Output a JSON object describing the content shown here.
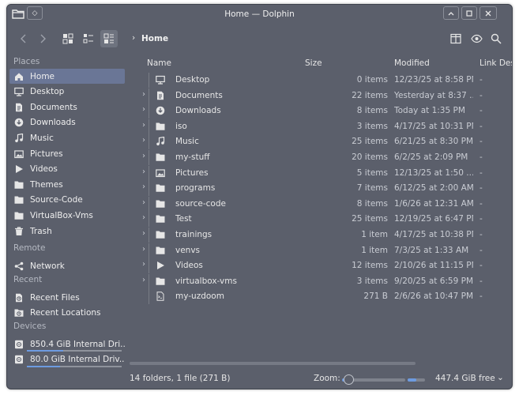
{
  "window": {
    "title": "Home — Dolphin"
  },
  "sidebar": {
    "sections": {
      "places": "Places",
      "remote": "Remote",
      "recent": "Recent",
      "devices": "Devices"
    },
    "places": [
      {
        "label": "Home",
        "icon": "home-icon",
        "selected": true
      },
      {
        "label": "Desktop",
        "icon": "desktop-icon"
      },
      {
        "label": "Documents",
        "icon": "document-icon"
      },
      {
        "label": "Downloads",
        "icon": "download-icon"
      },
      {
        "label": "Music",
        "icon": "music-icon"
      },
      {
        "label": "Pictures",
        "icon": "picture-icon"
      },
      {
        "label": "Videos",
        "icon": "video-icon"
      },
      {
        "label": "Themes",
        "icon": "folder-icon"
      },
      {
        "label": "Source-Code",
        "icon": "folder-icon"
      },
      {
        "label": "VirtualBox-Vms",
        "icon": "folder-icon"
      },
      {
        "label": "Trash",
        "icon": "trash-icon"
      }
    ],
    "remote": [
      {
        "label": "Network",
        "icon": "network-icon"
      }
    ],
    "recent": [
      {
        "label": "Recent Files",
        "icon": "recent-files-icon"
      },
      {
        "label": "Recent Locations",
        "icon": "recent-locations-icon"
      }
    ],
    "devices": [
      {
        "label": "850.4 GiB Internal Dri...",
        "icon": "drive-icon",
        "used_fraction": 0.38
      },
      {
        "label": "80.0 GiB Internal Driv...",
        "icon": "drive-icon",
        "used_fraction": 0.35
      }
    ]
  },
  "breadcrumb": {
    "location": "Home"
  },
  "columns": {
    "name": "Name",
    "size": "Size",
    "modified": "Modified",
    "link": "Link Desti"
  },
  "files": [
    {
      "name": "Desktop",
      "size": "0 items",
      "modified": "12/23/25 at 8:58 PM",
      "link": "-",
      "icon": "desktop-icon",
      "expandable": false
    },
    {
      "name": "Documents",
      "size": "22 items",
      "modified": "Yesterday at 8:37 ...",
      "link": "-",
      "icon": "document-icon",
      "expandable": true
    },
    {
      "name": "Downloads",
      "size": "8 items",
      "modified": "Today at 1:35 PM",
      "link": "-",
      "icon": "download-icon",
      "expandable": true
    },
    {
      "name": "iso",
      "size": "3 items",
      "modified": "4/17/25 at 10:31 PM",
      "link": "-",
      "icon": "folder-icon",
      "expandable": true
    },
    {
      "name": "Music",
      "size": "25 items",
      "modified": "6/21/25 at 8:30 PM",
      "link": "-",
      "icon": "music-icon",
      "expandable": true
    },
    {
      "name": "my-stuff",
      "size": "20 items",
      "modified": "6/2/25 at 2:09 PM",
      "link": "-",
      "icon": "folder-icon",
      "expandable": true
    },
    {
      "name": "Pictures",
      "size": "5 items",
      "modified": "12/13/25 at 1:50 ...",
      "link": "-",
      "icon": "picture-icon",
      "expandable": true
    },
    {
      "name": "programs",
      "size": "7 items",
      "modified": "6/12/25 at 2:00 AM",
      "link": "-",
      "icon": "folder-icon",
      "expandable": true
    },
    {
      "name": "source-code",
      "size": "8 items",
      "modified": "1/6/26 at 12:31 AM",
      "link": "-",
      "icon": "folder-icon",
      "expandable": true
    },
    {
      "name": "Test",
      "size": "25 items",
      "modified": "12/19/25 at 6:47 PM",
      "link": "-",
      "icon": "folder-icon",
      "expandable": true
    },
    {
      "name": "trainings",
      "size": "1 item",
      "modified": "4/17/25 at 10:38 PM",
      "link": "-",
      "icon": "folder-icon",
      "expandable": true
    },
    {
      "name": "venvs",
      "size": "1 item",
      "modified": "7/3/25 at 1:33 AM",
      "link": "-",
      "icon": "folder-icon",
      "expandable": true
    },
    {
      "name": "Videos",
      "size": "12 items",
      "modified": "2/10/26 at 11:15 PM",
      "link": "-",
      "icon": "video-icon",
      "expandable": true
    },
    {
      "name": "virtualbox-vms",
      "size": "3 items",
      "modified": "9/20/25 at 6:59 PM",
      "link": "-",
      "icon": "folder-icon",
      "expandable": true
    },
    {
      "name": "my-uzdoom",
      "size": "271 B",
      "modified": "2/6/26 at 10:47 PM",
      "link": "-",
      "icon": "script-icon",
      "expandable": false
    }
  ],
  "status": {
    "info": "14 folders, 1 file (271 B)",
    "zoom_label": "Zoom:",
    "zoom_fraction": 0.1,
    "free_space": "447.4 GiB free",
    "free_used_fraction": 0.5
  },
  "colors": {
    "window_bg": "#5b5f6b",
    "selection": "#6a7696",
    "accent": "#6d9be0"
  }
}
